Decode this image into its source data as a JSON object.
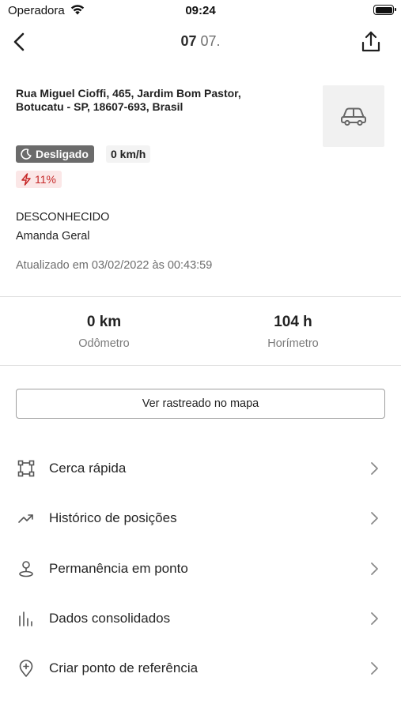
{
  "status_bar": {
    "carrier": "Operadora",
    "time": "09:24"
  },
  "header": {
    "title_bold": "07",
    "title_light": "07."
  },
  "vehicle": {
    "address_line1": "Rua Miguel Cioffi, 465, Jardim Bom Pastor,",
    "address_line2": "Botucatu - SP, 18607-693, Brasil",
    "ignition_label": "Desligado",
    "speed": "0 km/h",
    "battery": "11%",
    "driver_status": "DESCONHECIDO",
    "driver_name": "Amanda Geral",
    "updated": "Atualizado em 03/02/2022 às 00:43:59"
  },
  "stats": {
    "odometer_value": "0 km",
    "odometer_label": "Odômetro",
    "hourmeter_value": "104 h",
    "hourmeter_label": "Horímetro"
  },
  "map_button": "Ver rastreado no mapa",
  "menu": [
    {
      "label": "Cerca rápida",
      "icon": "fence-icon"
    },
    {
      "label": "Histórico de posições",
      "icon": "trend-icon"
    },
    {
      "label": "Permanência em ponto",
      "icon": "person-pin-icon"
    },
    {
      "label": "Dados consolidados",
      "icon": "bar-chart-icon"
    },
    {
      "label": "Criar ponto de referência",
      "icon": "location-add-icon"
    }
  ],
  "colors": {
    "badge_off_bg": "#6b6b6b",
    "battery_badge_bg": "#fbe7e7",
    "battery_badge_fg": "#c62828"
  }
}
